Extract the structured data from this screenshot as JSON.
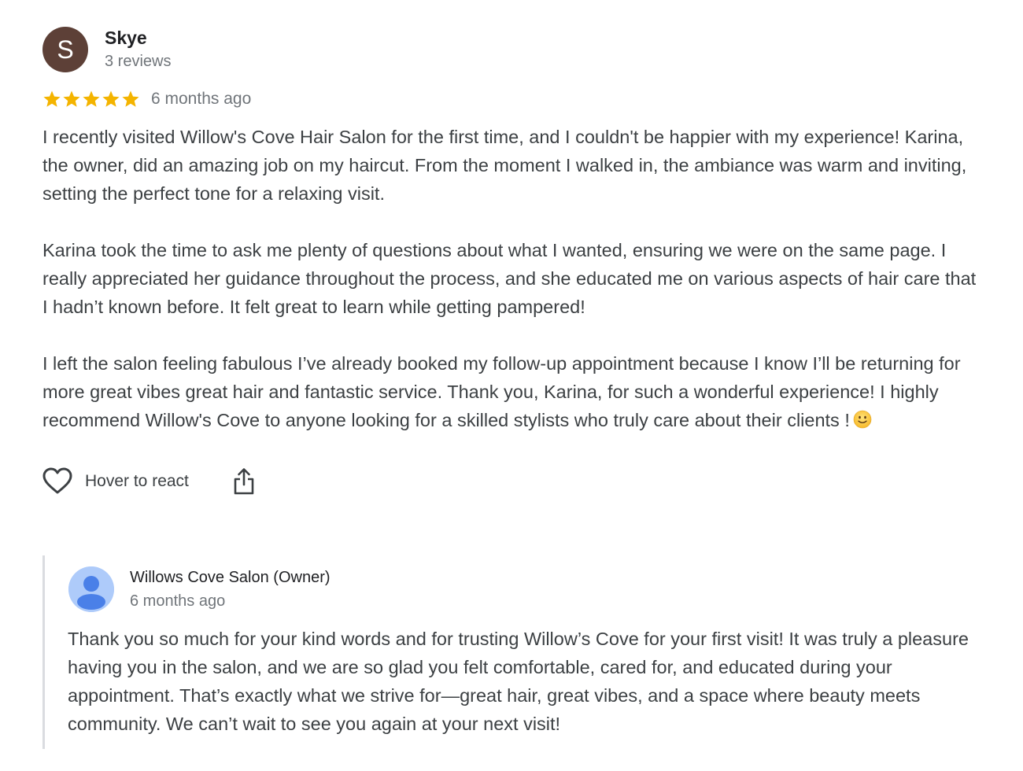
{
  "review": {
    "avatar_letter": "S",
    "avatar_color": "#5d4037",
    "reviewer_name": "Skye",
    "reviewer_count": "3 reviews",
    "rating": 5,
    "rating_max": 5,
    "star_color": "#f4b400",
    "date": "6 months ago",
    "paragraphs": [
      "I recently visited Willow's Cove Hair Salon for the first time, and I couldn't be happier with my experience! Karina, the owner, did an amazing job on my haircut. From the moment I walked in, the ambiance was warm and inviting, setting the perfect tone for a relaxing visit.",
      "Karina took the time to ask me plenty of questions about what I wanted, ensuring we were on the same page. I really appreciated her guidance throughout the process, and she educated me on various aspects of hair care that I hadn’t known before. It felt great to learn while getting pampered!",
      "I left the salon feeling fabulous I’ve already booked my follow-up appointment because I know I’ll be returning for more great vibes great hair and fantastic service. Thank you, Karina, for such a wonderful experience! I highly recommend Willow's Cove to anyone looking for a skilled stylists who truly care about their clients !"
    ],
    "trailing_emoji_icon": "slightly-smiling-face-icon"
  },
  "actions": {
    "react_icon": "heart-outline-icon",
    "react_label": "Hover to react",
    "share_icon": "share-icon"
  },
  "owner_reply": {
    "avatar_icon": "person-avatar-icon",
    "avatar_color": "#aecbfa",
    "name": "Willows Cove Salon (Owner)",
    "date": "6 months ago",
    "text": "Thank you so much for your kind words and for trusting Willow’s Cove for your first visit! It was truly a pleasure having you in the salon, and we are so glad you felt comfortable, cared for, and educated during your appointment. That’s exactly what we strive for—great hair, great vibes, and a space where beauty meets community. We can’t wait to see you again at your next visit!"
  }
}
